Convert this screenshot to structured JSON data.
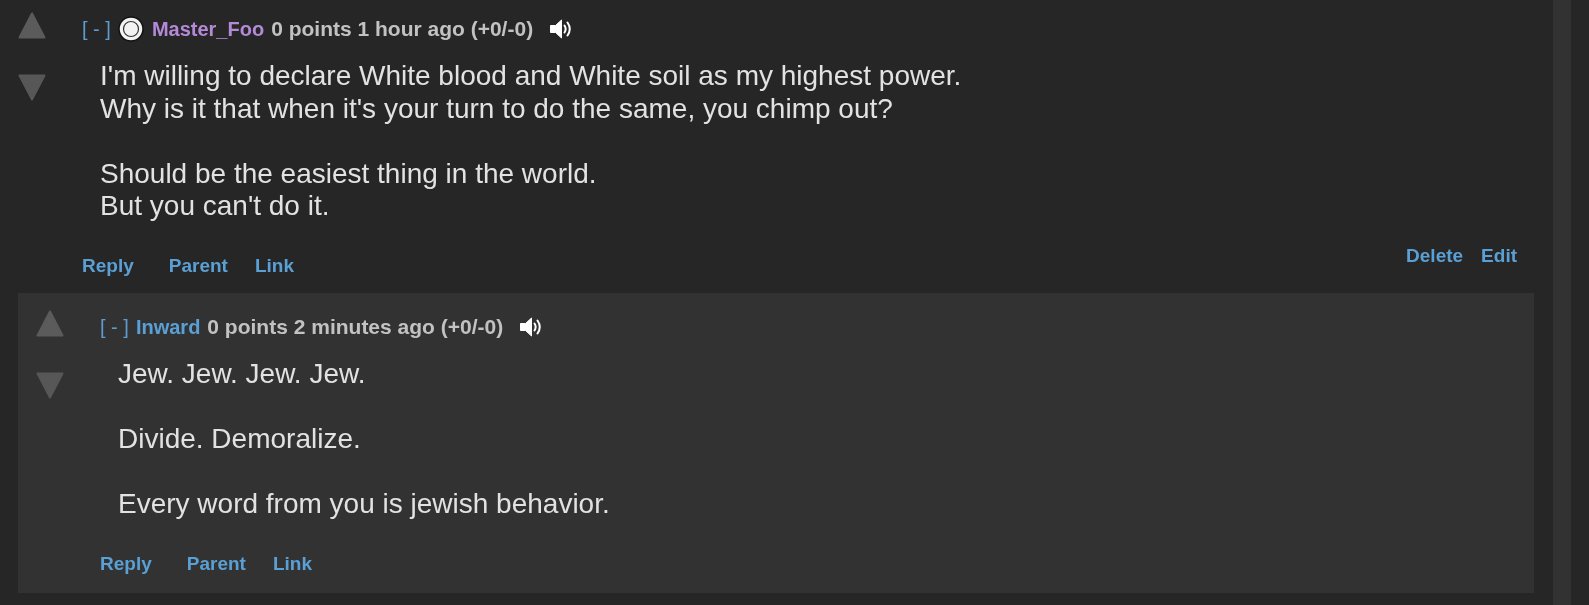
{
  "comments": [
    {
      "collapse_toggle": "[ - ]",
      "has_avatar": true,
      "author": {
        "name": "Master_Foo",
        "color": "#b48ad8"
      },
      "points": "0 points",
      "age": "1 hour ago",
      "vote_split": "(+0/-0)",
      "paragraphs": [
        "I'm willing to declare White blood and White soil as my highest power.\nWhy is it that when it's your turn to do the same, you chimp out?",
        "Should be the easiest thing in the world.\nBut you can't do it."
      ],
      "actions": [
        "Reply",
        "Parent",
        "Link"
      ],
      "owner_actions": [
        "Delete",
        "Edit"
      ],
      "children": [
        {
          "collapse_toggle": "[ - ]",
          "has_avatar": false,
          "author": {
            "name": "Inward",
            "color": "#5aa0d4"
          },
          "points": "0 points",
          "age": "2 minutes ago",
          "vote_split": "(+0/-0)",
          "paragraphs": [
            "Jew. Jew. Jew. Jew.",
            "Divide. Demoralize.",
            "Every word from you is jewish behavior."
          ],
          "actions": [
            "Reply",
            "Parent",
            "Link"
          ]
        }
      ]
    }
  ]
}
